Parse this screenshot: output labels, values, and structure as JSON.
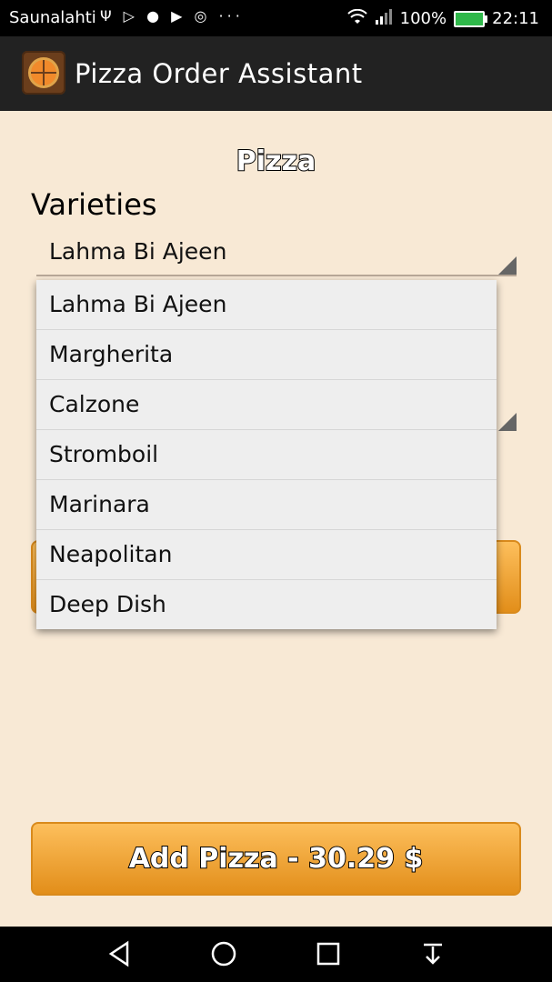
{
  "status_bar": {
    "carrier": "Saunalahti",
    "left_icons": "Ψ ▷ ● ▶ ◎ ···",
    "battery": "100%",
    "time": "22:11"
  },
  "app": {
    "title": "Pizza Order Assistant"
  },
  "main": {
    "section_title": "Pizza",
    "varieties_label": "Varieties",
    "selected_variety": "Lahma Bi Ajeen",
    "add_button_label": "Add Pizza - 30.29 $"
  },
  "dropdown": {
    "options": [
      "Lahma Bi Ajeen",
      "Margherita",
      "Calzone",
      "Stromboil",
      "Marinara",
      "Neapolitan",
      "Deep Dish"
    ]
  },
  "colors": {
    "background": "#f8e9d5",
    "accent_orange": "#f0a43a",
    "action_bar": "#222222"
  }
}
